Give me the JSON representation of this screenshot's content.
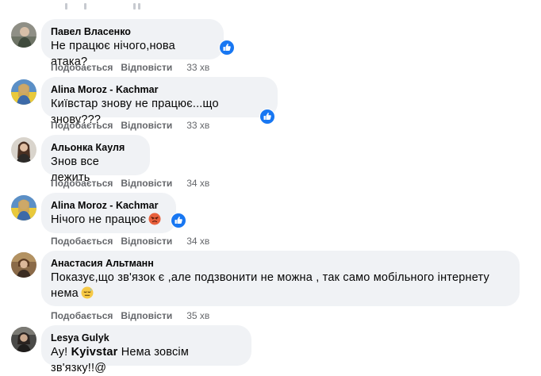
{
  "labels": {
    "like": "Подобається",
    "reply": "Відповісти"
  },
  "comments": [
    {
      "author": "Павел Власенко",
      "text": "Не працює нічого,нова атака?",
      "time": "33 хв"
    },
    {
      "author": "Alina Moroz - Kachmar",
      "text": "Київстар знову не працює...що знову???",
      "time": "33 хв"
    },
    {
      "author": "Альонка Кауля",
      "text": "Знов все лежить",
      "time": "34 хв"
    },
    {
      "author": "Alina Moroz - Kachmar",
      "text": "Нічого не працює",
      "time": "34 хв"
    },
    {
      "author": "Анастасия Альтманн",
      "text_line1": "Показує,що зв'язок є ,але подзвонити не можна , так само мобільного інтернету",
      "text_line2": "нема",
      "time": "35 хв"
    },
    {
      "author": "Lesya Gulyk",
      "text_pre": "Ау! ",
      "text_bold": "Kyivstar",
      "text_post": " Нема зовсім зв'язку!!@"
    }
  ],
  "colors": {
    "bubble": "#f0f2f5",
    "meta": "#65676b",
    "like_blue": "#1877f2"
  },
  "icons": [
    "like-icon",
    "angry-face-emoji",
    "downcast-sweat-emoji"
  ]
}
